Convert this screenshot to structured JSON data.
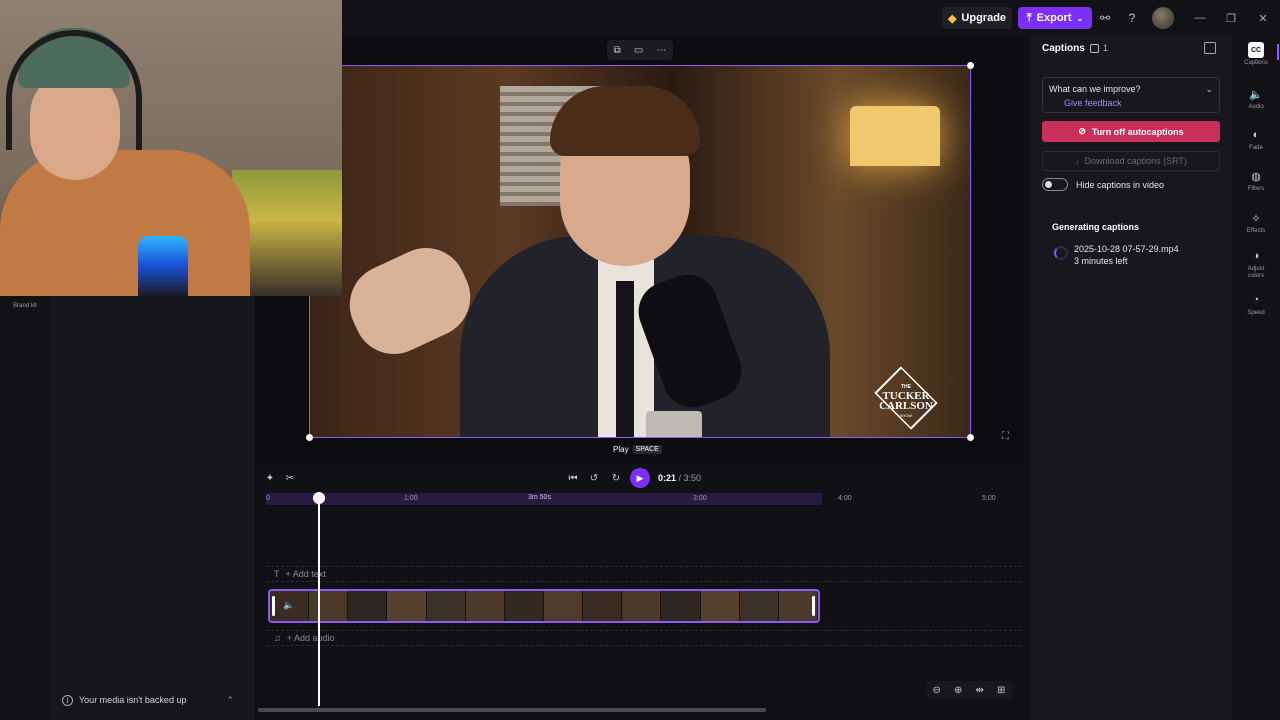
{
  "topbar": {
    "upgrade_label": "Upgrade",
    "export_label": "Export",
    "icons": [
      "share-link-icon",
      "help-icon",
      "avatar",
      "minimize-icon",
      "restore-icon",
      "close-icon"
    ]
  },
  "left": {
    "brand_kit_label": "Brand kit",
    "backup_notice": "Your media isn't backed up"
  },
  "preview": {
    "logo_line1": "THE",
    "logo_line2": "TUCKER",
    "logo_line3": "CARLSON",
    "logo_line4": "SHOW",
    "tooltip_label": "Play",
    "tooltip_key": "SPACE"
  },
  "timeline": {
    "current_time": "0:21",
    "total_time": "/ 3:50",
    "ruler_ticks": [
      "0",
      "1:00",
      "3:00",
      "4:00",
      "5:00"
    ],
    "duration_badge": "3m 50s",
    "add_text_label": "+ Add text",
    "add_audio_label": "+ Add audio"
  },
  "captions_panel": {
    "title": "Captions",
    "count": "1",
    "feedback_question": "What can we improve?",
    "feedback_link": "Give feedback",
    "turn_off_label": "Turn off autocaptions",
    "download_label": "Download captions (SRT)",
    "hide_toggle_label": "Hide captions in video",
    "hide_toggle_on": false,
    "generating_title": "Generating captions",
    "file_name": "2025-10-28 07-57-29.mp4",
    "time_left": "3 minutes left"
  },
  "rail": {
    "items": [
      {
        "label": "Captions",
        "icon": "captions-icon",
        "active": true
      },
      {
        "label": "Audio",
        "icon": "audio-icon"
      },
      {
        "label": "Fade",
        "icon": "fade-icon"
      },
      {
        "label": "Filters",
        "icon": "filters-icon"
      },
      {
        "label": "Effects",
        "icon": "effects-icon"
      },
      {
        "label": "Adjust colors",
        "icon": "adjust-colors-icon"
      },
      {
        "label": "Speed",
        "icon": "speed-icon"
      }
    ]
  },
  "colors": {
    "accent": "#7b2ff7",
    "selection": "#8b5cf6",
    "danger": "#c8305a",
    "link": "#a78bfa"
  }
}
